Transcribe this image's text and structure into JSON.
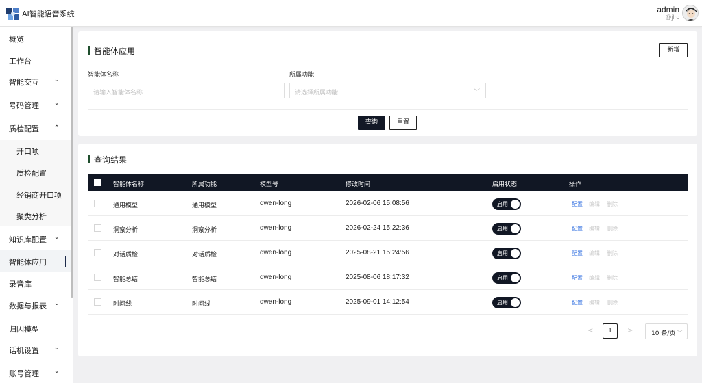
{
  "header": {
    "app_title": "AI智能语音系统",
    "user_name": "admin",
    "user_handle": "@jlrc"
  },
  "sidebar": {
    "items": [
      {
        "label": "概览",
        "chevron": ""
      },
      {
        "label": "工作台",
        "chevron": ""
      },
      {
        "label": "智能交互",
        "chevron": "⌄"
      },
      {
        "label": "号码管理",
        "chevron": "⌄"
      },
      {
        "label": "质检配置",
        "chevron": "⌃"
      },
      {
        "label": "开口项",
        "chevron": ""
      },
      {
        "label": "质检配置",
        "chevron": ""
      },
      {
        "label": "经销商开口项",
        "chevron": ""
      },
      {
        "label": "聚类分析",
        "chevron": ""
      },
      {
        "label": "知识库配置",
        "chevron": "⌄"
      },
      {
        "label": "智能体应用",
        "chevron": ""
      },
      {
        "label": "录音库",
        "chevron": ""
      },
      {
        "label": "数据与报表",
        "chevron": "⌄"
      },
      {
        "label": "归因模型",
        "chevron": ""
      },
      {
        "label": "话机设置",
        "chevron": "⌄"
      },
      {
        "label": "账号管理",
        "chevron": "⌄"
      }
    ]
  },
  "search": {
    "title": "智能体应用",
    "new_button": "新增",
    "name_label": "智能体名称",
    "name_placeholder": "请输入智能体名称",
    "func_label": "所属功能",
    "func_placeholder": "请选择所属功能",
    "query_button": "查询",
    "reset_button": "重置"
  },
  "results": {
    "title": "查询结果",
    "columns": [
      "智能体名称",
      "所属功能",
      "模型号",
      "修改时间",
      "启用状态",
      "操作"
    ],
    "rows": [
      {
        "name": "通用模型",
        "func": "通用模型",
        "model": "qwen-long",
        "time": "2026-02-06 15:08:56",
        "status": "启用"
      },
      {
        "name": "洞察分析",
        "func": "洞察分析",
        "model": "qwen-long",
        "time": "2026-02-24 15:22:36",
        "status": "启用"
      },
      {
        "name": "对话质检",
        "func": "对话质检",
        "model": "qwen-long",
        "time": "2025-08-21 15:24:56",
        "status": "启用"
      },
      {
        "name": "智能总结",
        "func": "智能总结",
        "model": "qwen-long",
        "time": "2025-08-06 18:17:32",
        "status": "启用"
      },
      {
        "name": "时间线",
        "func": "时间线",
        "model": "qwen-long",
        "time": "2025-09-01 14:12:54",
        "status": "启用"
      }
    ],
    "actions": {
      "config": "配置",
      "edit": "编辑",
      "delete": "删除"
    }
  },
  "pagination": {
    "prev": "<",
    "next": ">",
    "current_page": "1",
    "page_size": "10 条/页"
  },
  "colors": {
    "accent_bar": "#1f4e2d",
    "table_header": "#111724",
    "link": "#2f6ee0"
  }
}
